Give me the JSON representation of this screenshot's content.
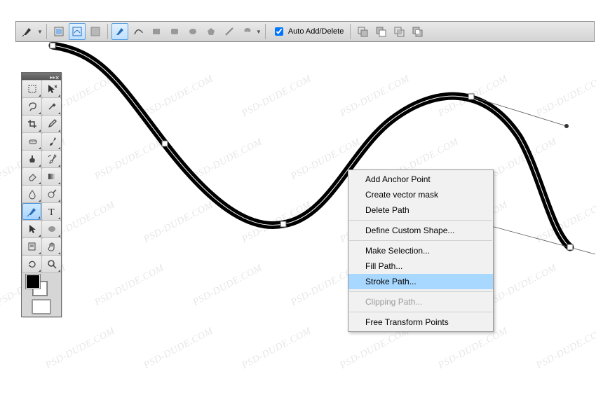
{
  "options_bar": {
    "auto_add_delete_label": "Auto Add/Delete",
    "auto_add_delete_checked": true
  },
  "context_menu": {
    "items": [
      {
        "label": "Add Anchor Point",
        "disabled": false
      },
      {
        "label": "Create vector mask",
        "disabled": false
      },
      {
        "label": "Delete Path",
        "disabled": false
      },
      {
        "sep": true
      },
      {
        "label": "Define Custom Shape...",
        "disabled": false
      },
      {
        "sep": true
      },
      {
        "label": "Make Selection...",
        "disabled": false
      },
      {
        "label": "Fill Path...",
        "disabled": false
      },
      {
        "label": "Stroke Path...",
        "disabled": false,
        "highlight": true
      },
      {
        "sep": true
      },
      {
        "label": "Clipping Path...",
        "disabled": true
      },
      {
        "sep": true
      },
      {
        "label": "Free Transform Points",
        "disabled": false
      }
    ]
  },
  "tools": {
    "names": [
      "marquee",
      "move",
      "lasso",
      "magic-wand",
      "crop",
      "eyedropper",
      "healing",
      "brush",
      "clone",
      "history-brush",
      "eraser",
      "gradient",
      "blur",
      "dodge",
      "pen",
      "type",
      "path-select",
      "shape",
      "notes",
      "hand",
      "rotate",
      "zoom"
    ],
    "selected": "pen"
  },
  "swatches": {
    "fg": "#000000",
    "bg": "#ffffff"
  },
  "watermark_text": "PSD-DUDE.COM"
}
